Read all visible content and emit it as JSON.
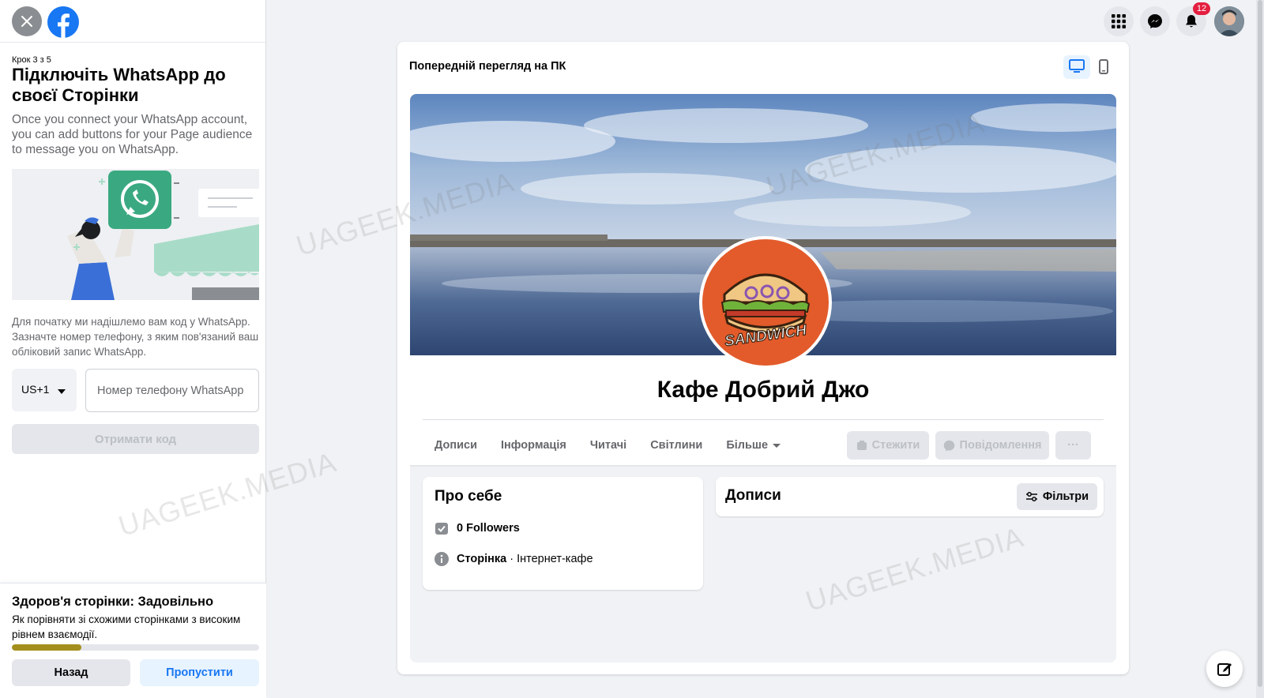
{
  "wizard": {
    "step": "Крок 3 з 5",
    "title": "Підключіть WhatsApp до своєї Сторінки",
    "description": "Once you connect your WhatsApp account, you can add buttons for your Page audience to message you on WhatsApp.",
    "info": "Для початку ми надішлемо вам код у WhatsApp. Зазначте номер телефону, з яким пов'язаний ваш обліковий запис WhatsApp.",
    "country_code": "US+1",
    "phone_placeholder": "Номер телефону WhatsApp",
    "get_code_label": "Отримати код"
  },
  "health": {
    "title": "Здоров'я сторінки: Задовільно",
    "description": "Як порівняти зі схожими сторінками з високим рівнем взаємодії.",
    "progress": 0.28,
    "back_label": "Назад",
    "skip_label": "Пропустити"
  },
  "header": {
    "notification_count": "12"
  },
  "preview": {
    "title": "Попередній перегляд на ПК",
    "page_name": "Кафе Добрий Джо",
    "profile_text": "SANDWICH",
    "tabs": [
      "Дописи",
      "Інформація",
      "Читачі",
      "Світлини",
      "Більше"
    ],
    "follow_label": "Стежити",
    "message_label": "Повідомлення",
    "more_label": "···",
    "about": {
      "title": "Про себе",
      "followers": "0 Followers",
      "page_type_label": "Сторінка",
      "page_type_value": " · Інтернет-кафе"
    },
    "posts": {
      "title": "Дописи",
      "filters_label": "Фільтри"
    }
  },
  "watermark": "UAGEEK.MEDIA",
  "colors": {
    "facebook_blue": "#1877f2",
    "whatsapp_green": "#3aa981",
    "health_fill": "#a48f1e",
    "badge_red": "#e41e3f"
  }
}
